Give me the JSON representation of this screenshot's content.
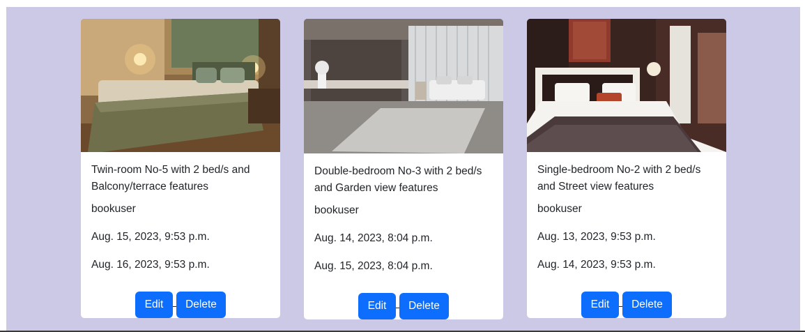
{
  "bookings": [
    {
      "image_alt": "Twin-room with green bedspread and lamps",
      "title": "Twin-room No-5 with 2 bed/s and Balcony/terrace features",
      "user": "bookuser",
      "check_in": "Aug. 15, 2023, 9:53 p.m.",
      "check_out": "Aug. 16, 2023, 9:53 p.m.",
      "edit_label": "Edit",
      "delete_label": "Delete"
    },
    {
      "image_alt": "Double-bedroom with grey rug and large window",
      "title": "Double-bedroom No-3 with 2 bed/s and Garden view features",
      "user": "bookuser",
      "check_in": "Aug. 14, 2023, 8:04 p.m.",
      "check_out": "Aug. 15, 2023, 8:04 p.m.",
      "edit_label": "Edit",
      "delete_label": "Delete"
    },
    {
      "image_alt": "Single-bedroom with dark headboard and orange pillow",
      "title": "Single-bedroom No-2 with 2 bed/s and Street view features",
      "user": "bookuser",
      "check_in": "Aug. 13, 2023, 9:53 p.m.",
      "check_out": "Aug. 14, 2023, 9:53 p.m.",
      "edit_label": "Edit",
      "delete_label": "Delete"
    }
  ],
  "colors": {
    "background": "#cbc9e6",
    "card": "#ffffff",
    "button": "#0d6efd",
    "text": "#212529"
  }
}
